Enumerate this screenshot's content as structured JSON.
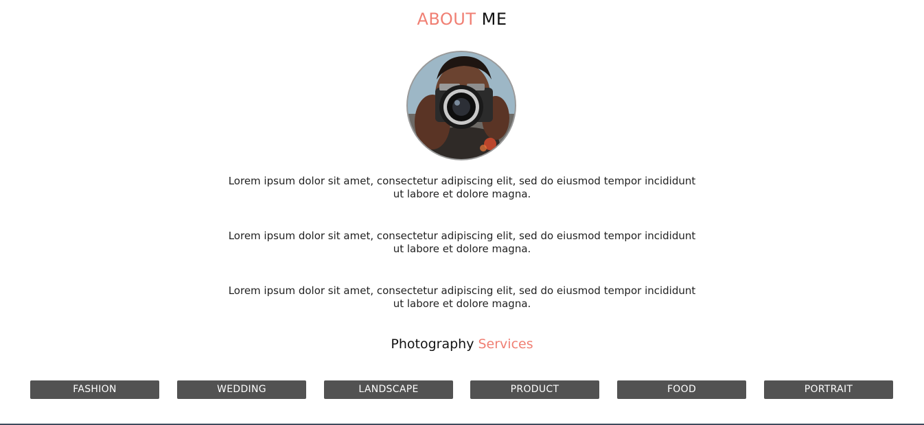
{
  "about": {
    "title_accent": "ABOUT",
    "title_rest": " ME"
  },
  "bio": {
    "paragraphs": [
      "Lorem ipsum dolor sit amet, consectetur adipiscing elit, sed do eiusmod tempor incididunt ut labore et dolore magna.",
      "Lorem ipsum dolor sit amet, consectetur adipiscing elit, sed do eiusmod tempor incididunt ut labore et dolore magna.",
      "Lorem ipsum dolor sit amet, consectetur adipiscing elit, sed do eiusmod tempor incididunt ut labore et dolore magna."
    ]
  },
  "services": {
    "title_main": "Photography ",
    "title_accent": "Services",
    "buttons": [
      "FASHION",
      "WEDDING",
      "LANDSCAPE",
      "PRODUCT",
      "FOOD",
      "PORTRAIT"
    ]
  },
  "colors": {
    "accent": "#f07f73",
    "button_bg": "#525252",
    "button_text": "#ffffff"
  }
}
